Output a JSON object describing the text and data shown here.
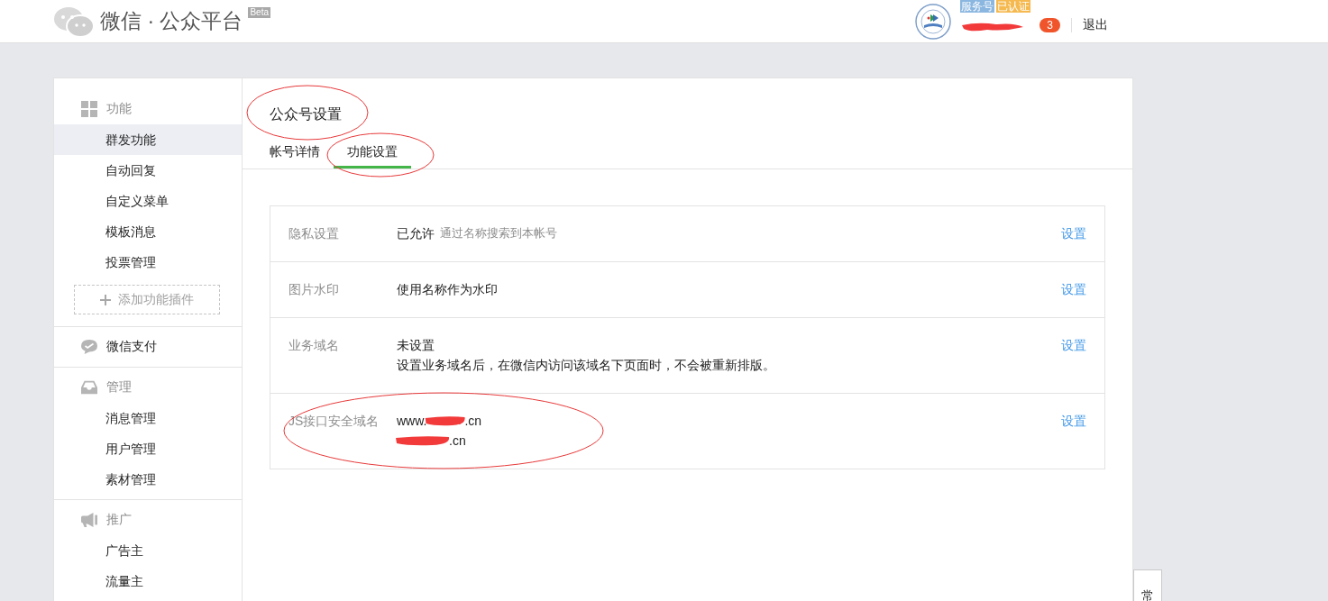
{
  "header": {
    "logo": "微信 · 公众平台",
    "beta": "Beta",
    "tags": [
      {
        "label": "服务号",
        "color": "#8ab6e0"
      },
      {
        "label": "已认证",
        "color": "#f5b94f"
      }
    ],
    "notice_count": "3",
    "logout": "退出"
  },
  "sidebar": [
    {
      "kind": "group",
      "label": "功能",
      "items": [
        {
          "label": "群发功能",
          "selected": true
        },
        {
          "label": "自动回复",
          "selected": false
        },
        {
          "label": "自定义菜单",
          "selected": false
        },
        {
          "label": "模板消息",
          "selected": false
        },
        {
          "label": "投票管理",
          "selected": false
        }
      ],
      "add_button": "添加功能插件"
    },
    {
      "kind": "link",
      "label": "微信支付"
    },
    {
      "kind": "group",
      "label": "管理",
      "items": [
        {
          "label": "消息管理",
          "selected": false
        },
        {
          "label": "用户管理",
          "selected": false
        },
        {
          "label": "素材管理",
          "selected": false
        }
      ]
    },
    {
      "kind": "group",
      "label": "推广",
      "items": [
        {
          "label": "广告主",
          "selected": false
        },
        {
          "label": "流量主",
          "selected": false
        }
      ]
    }
  ],
  "page": {
    "title": "公众号设置",
    "title_circled": true,
    "tabs": [
      {
        "label": "帐号详情",
        "selected": false,
        "circled": false
      },
      {
        "label": "功能设置",
        "selected": true,
        "circled": true
      }
    ],
    "settings": [
      {
        "label": "隐私设置",
        "value": "已允许",
        "note": "通过名称搜索到本帐号",
        "action": "设置",
        "circled": false
      },
      {
        "label": "图片水印",
        "value": "使用名称作为水印",
        "action": "设置",
        "circled": false
      },
      {
        "label": "业务域名",
        "value": "未设置",
        "description": "设置业务域名后，在微信内访问该域名下页面时，不会被重新排版。",
        "action": "设置",
        "circled": false
      },
      {
        "label": "JS接口安全域名",
        "domains": [
          {
            "before": "www.",
            "after": ".cn"
          },
          {
            "after": ".cn"
          }
        ],
        "action": "设置",
        "circled": true
      }
    ]
  },
  "side_widget": {
    "label": "常"
  }
}
